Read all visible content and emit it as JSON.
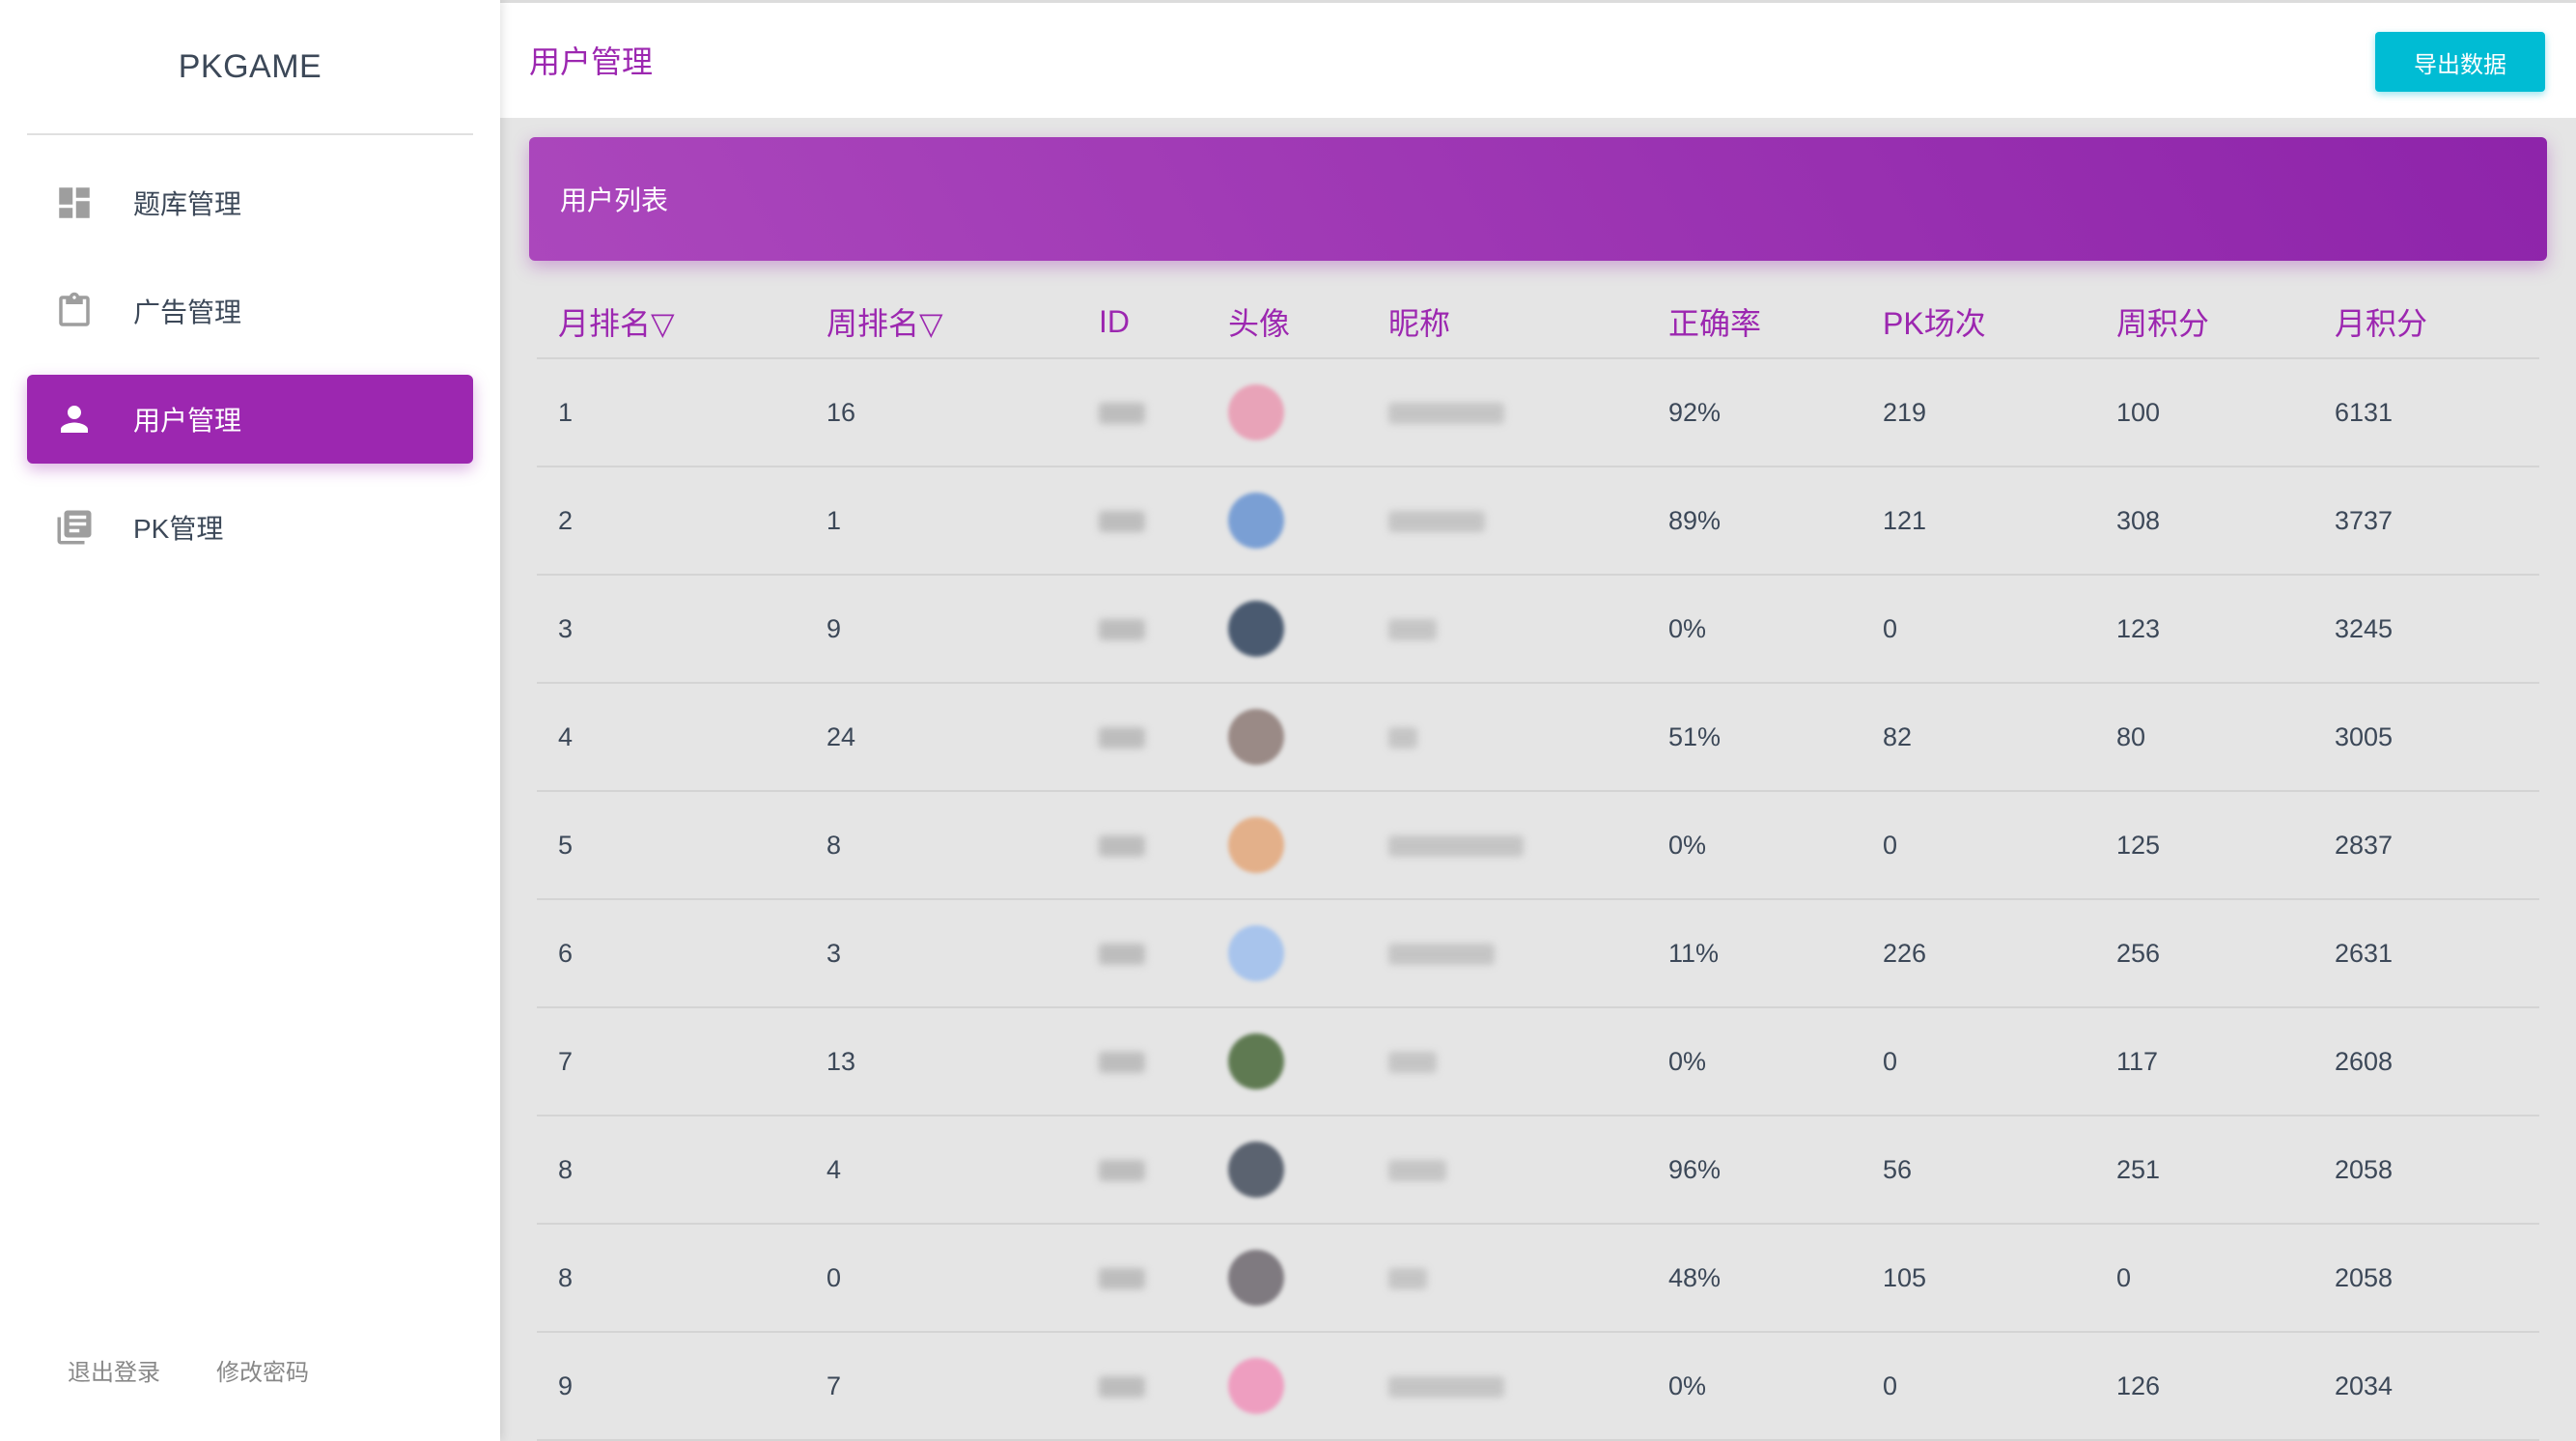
{
  "sidebar": {
    "brand": "PKGAME",
    "items": [
      {
        "label": "题库管理",
        "icon": "dashboard-icon",
        "active": false
      },
      {
        "label": "广告管理",
        "icon": "clipboard-icon",
        "active": false
      },
      {
        "label": "用户管理",
        "icon": "person-icon",
        "active": true
      },
      {
        "label": "PK管理",
        "icon": "library-books-icon",
        "active": false
      }
    ],
    "logout_label": "退出登录",
    "change_password_label": "修改密码"
  },
  "topbar": {
    "title": "用户管理",
    "export_label": "导出数据"
  },
  "card": {
    "title": "用户列表"
  },
  "table": {
    "headers": [
      "月排名▽",
      "周排名▽",
      "ID",
      "头像",
      "昵称",
      "正确率",
      "PK场次",
      "周积分",
      "月积分"
    ],
    "rows": [
      {
        "month_rank": "1",
        "week_rank": "16",
        "accuracy": "92%",
        "pk_count": "219",
        "week_score": "100",
        "month_score": "6131",
        "avatar_color": "#e8a3b8"
      },
      {
        "month_rank": "2",
        "week_rank": "1",
        "accuracy": "89%",
        "pk_count": "121",
        "week_score": "308",
        "month_score": "3737",
        "avatar_color": "#7a9fd4"
      },
      {
        "month_rank": "3",
        "week_rank": "9",
        "accuracy": "0%",
        "pk_count": "0",
        "week_score": "123",
        "month_score": "3245",
        "avatar_color": "#4a5a70"
      },
      {
        "month_rank": "4",
        "week_rank": "24",
        "accuracy": "51%",
        "pk_count": "82",
        "week_score": "80",
        "month_score": "3005",
        "avatar_color": "#9a8a86"
      },
      {
        "month_rank": "5",
        "week_rank": "8",
        "accuracy": "0%",
        "pk_count": "0",
        "week_score": "125",
        "month_score": "2837",
        "avatar_color": "#e3b08a"
      },
      {
        "month_rank": "6",
        "week_rank": "3",
        "accuracy": "11%",
        "pk_count": "226",
        "week_score": "256",
        "month_score": "2631",
        "avatar_color": "#a8c4ec"
      },
      {
        "month_rank": "7",
        "week_rank": "13",
        "accuracy": "0%",
        "pk_count": "0",
        "week_score": "117",
        "month_score": "2608",
        "avatar_color": "#5f7a52"
      },
      {
        "month_rank": "8",
        "week_rank": "4",
        "accuracy": "96%",
        "pk_count": "56",
        "week_score": "251",
        "month_score": "2058",
        "avatar_color": "#5b6370"
      },
      {
        "month_rank": "8",
        "week_rank": "0",
        "accuracy": "48%",
        "pk_count": "105",
        "week_score": "0",
        "month_score": "2058",
        "avatar_color": "#7f7a80"
      },
      {
        "month_rank": "9",
        "week_rank": "7",
        "accuracy": "0%",
        "pk_count": "0",
        "week_score": "126",
        "month_score": "2034",
        "avatar_color": "#ee9ec0"
      }
    ]
  },
  "colors": {
    "accent": "#9c27b0",
    "button": "#00bcd4"
  }
}
